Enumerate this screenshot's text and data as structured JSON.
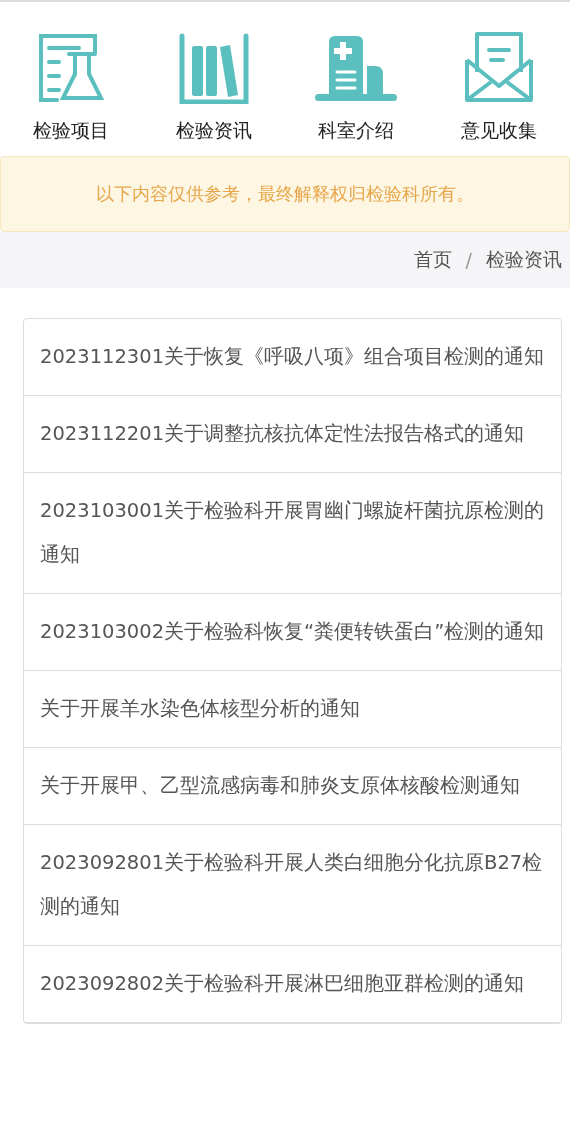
{
  "nav": [
    {
      "kind": "flask",
      "label": "检验项目"
    },
    {
      "kind": "books",
      "label": "检验资讯"
    },
    {
      "kind": "building",
      "label": "科室介绍"
    },
    {
      "kind": "mail",
      "label": "意见收集"
    }
  ],
  "notice": "以下内容仅供参考，最终解释权归检验科所有。",
  "breadcrumb": {
    "items": [
      "首页",
      "检验资讯"
    ],
    "separator": "/"
  },
  "news": [
    "2023112301关于恢复《呼吸八项》组合项目检测的通知",
    "2023112201关于调整抗核抗体定性法报告格式的通知",
    "2023103001关于检验科开展胃幽门螺旋杆菌抗原检测的通知",
    "2023103002关于检验科恢复“粪便转铁蛋白”检测的通知",
    "关于开展羊水染色体核型分析的通知",
    "关于开展甲、乙型流感病毒和肺炎支原体核酸检测通知",
    "2023092801关于检验科开展人类白细胞分化抗原B27检测的通知",
    "2023092802关于检验科开展淋巴细胞亚群检测的通知"
  ]
}
